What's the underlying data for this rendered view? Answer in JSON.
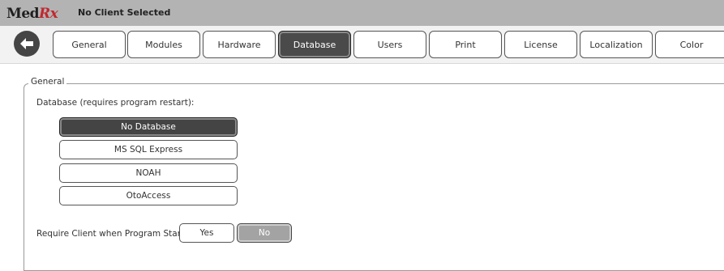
{
  "app": {
    "logo_med": "Med",
    "logo_rx": "Rx",
    "client_status": "No Client Selected"
  },
  "toolbar": {
    "back_icon": "arrow-left-icon",
    "tabs": [
      {
        "label": "General"
      },
      {
        "label": "Modules"
      },
      {
        "label": "Hardware"
      },
      {
        "label": "Database",
        "active": true
      },
      {
        "label": "Users"
      },
      {
        "label": "Print"
      },
      {
        "label": "License"
      },
      {
        "label": "Localization"
      },
      {
        "label": "Color"
      }
    ]
  },
  "general": {
    "legend": "General",
    "database_label": "Database (requires program restart):",
    "database_options": [
      {
        "label": "No Database",
        "selected": true
      },
      {
        "label": "MS SQL Express"
      },
      {
        "label": "NOAH"
      },
      {
        "label": "OtoAccess"
      }
    ],
    "require_client_label": "Require Client when Program Starts:",
    "yes_label": "Yes",
    "no_label": "No",
    "require_client_selected": "No"
  },
  "colors": {
    "titlebar": "#b3b3b3",
    "active": "#4a4a4a",
    "logo_rx": "#c0282f"
  }
}
